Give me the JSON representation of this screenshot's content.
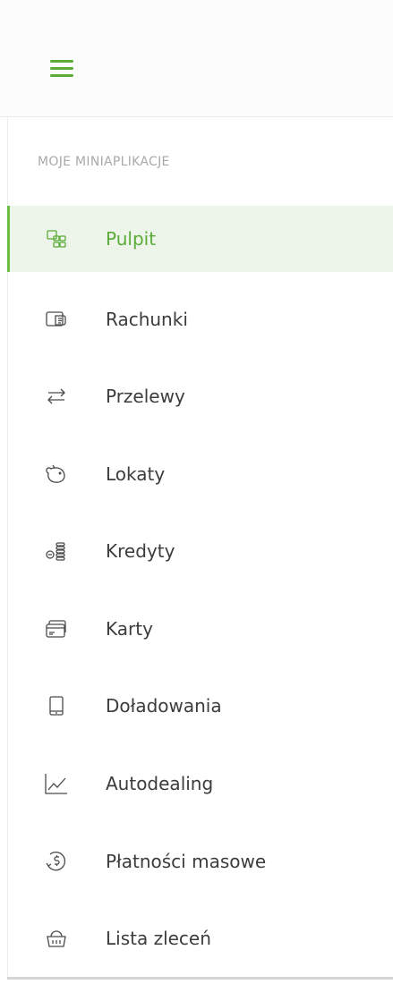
{
  "header": {
    "menu_icon": "hamburger-icon",
    "accent_color": "#5aab37"
  },
  "section": {
    "label": "MOJE MINIAPLIKACJE"
  },
  "menu": {
    "items": [
      {
        "label": "Pulpit",
        "icon": "dashboard-icon",
        "active": true
      },
      {
        "label": "Rachunki",
        "icon": "wallet-icon",
        "active": false
      },
      {
        "label": "Przelewy",
        "icon": "transfer-arrows-icon",
        "active": false
      },
      {
        "label": "Lokaty",
        "icon": "piggy-bank-icon",
        "active": false
      },
      {
        "label": "Kredyty",
        "icon": "coins-stack-icon",
        "active": false
      },
      {
        "label": "Karty",
        "icon": "cards-icon",
        "active": false
      },
      {
        "label": "Doładowania",
        "icon": "phone-icon",
        "active": false
      },
      {
        "label": "Autodealing",
        "icon": "chart-line-icon",
        "active": false
      },
      {
        "label": "Płatności masowe",
        "icon": "dollar-coin-icon",
        "active": false
      },
      {
        "label": "Lista zleceń",
        "icon": "basket-icon",
        "active": false
      }
    ]
  },
  "colors": {
    "active_bg": "#edf5ea",
    "active_text": "#5aab37",
    "text": "#3c3c3c",
    "muted": "#a8aaa8"
  }
}
